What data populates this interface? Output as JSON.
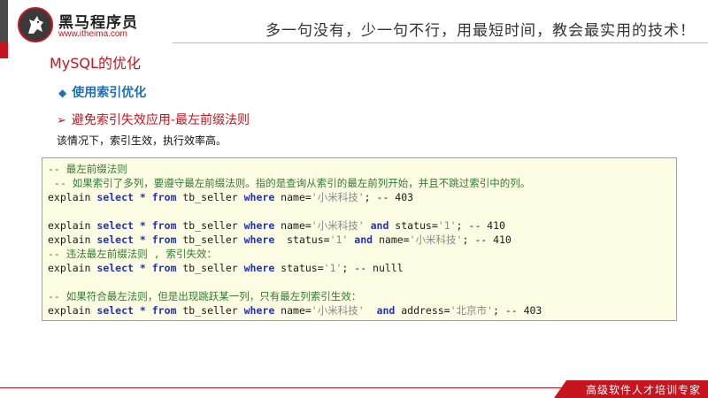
{
  "header": {
    "logo_title": "黑马程序员",
    "logo_url": "www.itheima.com",
    "slogan": "多一句没有，少一句不行，用最短时间，教会最实用的技术！"
  },
  "section_title": "MySQL的优化",
  "subtopic": "使用索引优化",
  "point": "避免索引失效应用-最左前缀法则",
  "description": "该情况下，索引生效，执行效率高。",
  "code": {
    "lines": [
      {
        "tokens": [
          {
            "t": "c",
            "v": "-- 最左前缀法则"
          }
        ]
      },
      {
        "tokens": [
          {
            "t": "c",
            "v": " -- 如果索引了多列，要遵守最左前缀法则。指的是查询从索引的最左前列开始，并且不跳过索引中的列。"
          }
        ]
      },
      {
        "tokens": [
          {
            "t": "p",
            "v": "explain "
          },
          {
            "t": "k",
            "v": "select"
          },
          {
            "t": "p",
            "v": " "
          },
          {
            "t": "k",
            "v": "*"
          },
          {
            "t": "p",
            "v": " "
          },
          {
            "t": "k",
            "v": "from"
          },
          {
            "t": "p",
            "v": " tb_seller "
          },
          {
            "t": "k",
            "v": "where"
          },
          {
            "t": "p",
            "v": " name="
          },
          {
            "t": "s",
            "v": "'小米科技'"
          },
          {
            "t": "p",
            "v": "; -- 403"
          }
        ]
      },
      {
        "tokens": []
      },
      {
        "tokens": [
          {
            "t": "p",
            "v": "explain "
          },
          {
            "t": "k",
            "v": "select"
          },
          {
            "t": "p",
            "v": " "
          },
          {
            "t": "k",
            "v": "*"
          },
          {
            "t": "p",
            "v": " "
          },
          {
            "t": "k",
            "v": "from"
          },
          {
            "t": "p",
            "v": " tb_seller "
          },
          {
            "t": "k",
            "v": "where"
          },
          {
            "t": "p",
            "v": " name="
          },
          {
            "t": "s",
            "v": "'小米科技'"
          },
          {
            "t": "p",
            "v": " "
          },
          {
            "t": "k",
            "v": "and"
          },
          {
            "t": "p",
            "v": " status="
          },
          {
            "t": "s",
            "v": "'1'"
          },
          {
            "t": "p",
            "v": "; -- 410"
          }
        ]
      },
      {
        "tokens": [
          {
            "t": "p",
            "v": "explain "
          },
          {
            "t": "k",
            "v": "select"
          },
          {
            "t": "p",
            "v": " "
          },
          {
            "t": "k",
            "v": "*"
          },
          {
            "t": "p",
            "v": " "
          },
          {
            "t": "k",
            "v": "from"
          },
          {
            "t": "p",
            "v": " tb_seller "
          },
          {
            "t": "k",
            "v": "where"
          },
          {
            "t": "p",
            "v": "  status="
          },
          {
            "t": "s",
            "v": "'1'"
          },
          {
            "t": "p",
            "v": " "
          },
          {
            "t": "k",
            "v": "and"
          },
          {
            "t": "p",
            "v": " name="
          },
          {
            "t": "s",
            "v": "'小米科技'"
          },
          {
            "t": "p",
            "v": "; -- 410"
          }
        ]
      },
      {
        "tokens": [
          {
            "t": "c",
            "v": "-- 违法最左前缀法则 , 索引失效："
          }
        ]
      },
      {
        "tokens": [
          {
            "t": "p",
            "v": "explain "
          },
          {
            "t": "k",
            "v": "select"
          },
          {
            "t": "p",
            "v": " "
          },
          {
            "t": "k",
            "v": "*"
          },
          {
            "t": "p",
            "v": " "
          },
          {
            "t": "k",
            "v": "from"
          },
          {
            "t": "p",
            "v": " tb_seller "
          },
          {
            "t": "k",
            "v": "where"
          },
          {
            "t": "p",
            "v": " status="
          },
          {
            "t": "s",
            "v": "'1'"
          },
          {
            "t": "p",
            "v": "; -- nulll"
          }
        ]
      },
      {
        "tokens": []
      },
      {
        "tokens": [
          {
            "t": "c",
            "v": "-- 如果符合最左法则，但是出现跳跃某一列，只有最左列索引生效："
          }
        ]
      },
      {
        "tokens": [
          {
            "t": "p",
            "v": "explain "
          },
          {
            "t": "k",
            "v": "select"
          },
          {
            "t": "p",
            "v": " "
          },
          {
            "t": "k",
            "v": "*"
          },
          {
            "t": "p",
            "v": " "
          },
          {
            "t": "k",
            "v": "from"
          },
          {
            "t": "p",
            "v": " tb_seller "
          },
          {
            "t": "k",
            "v": "where"
          },
          {
            "t": "p",
            "v": " name="
          },
          {
            "t": "s",
            "v": "'小米科技'"
          },
          {
            "t": "p",
            "v": "  "
          },
          {
            "t": "k",
            "v": "and"
          },
          {
            "t": "p",
            "v": " address="
          },
          {
            "t": "s",
            "v": "'北京市'"
          },
          {
            "t": "p",
            "v": "; -- 403"
          }
        ]
      }
    ]
  },
  "footer": {
    "tagline": "高级软件人才培训专家"
  },
  "colors": {
    "brand_red": "#c8141e",
    "subtopic_blue": "#1f6fb5",
    "keyword_blue": "#1f2fd0",
    "comment_green": "#2e7d32",
    "code_bg": "#fdfde3"
  },
  "icons": {
    "logo": "horse-head-icon",
    "bullet": "diamond-icon",
    "arrow": "arrow-right-icon"
  }
}
